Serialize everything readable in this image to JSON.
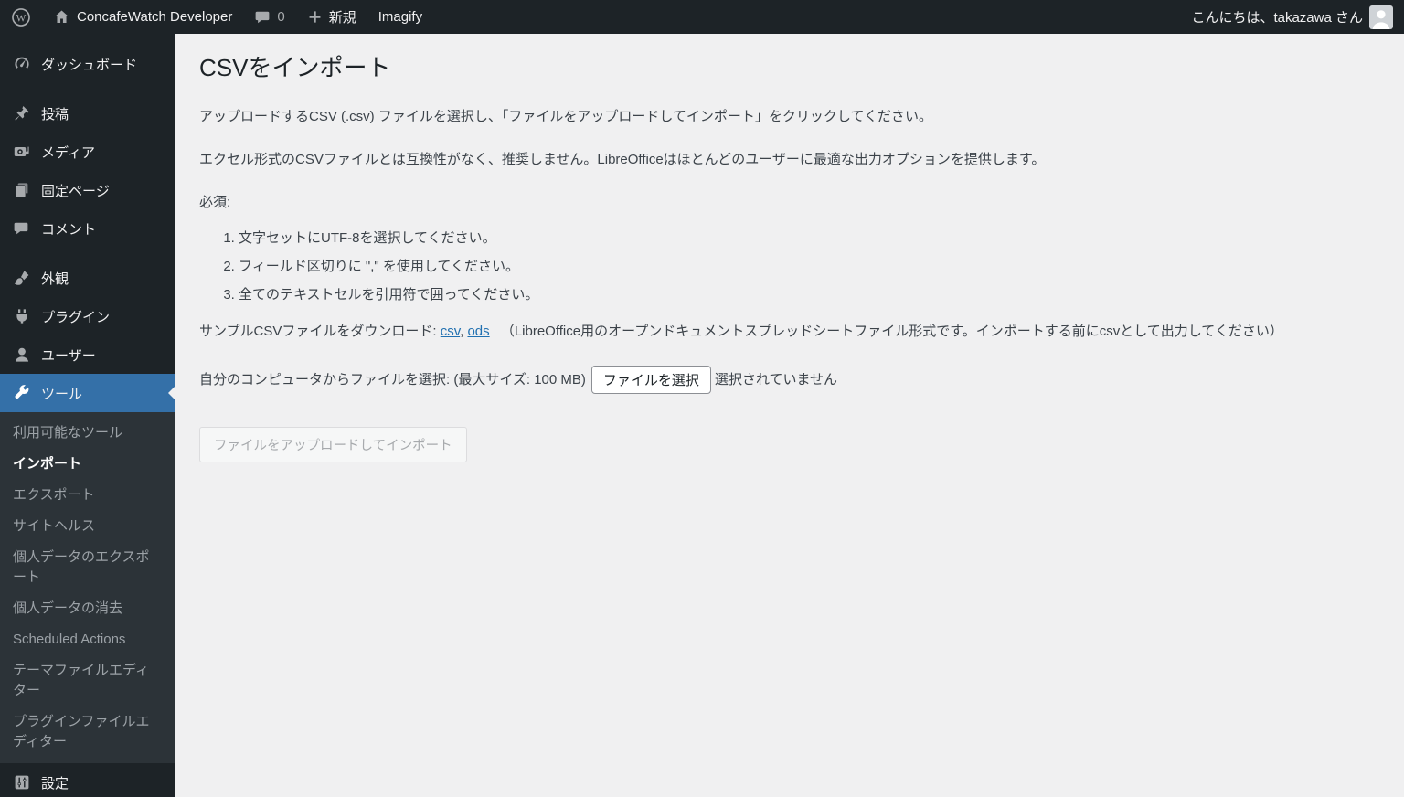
{
  "admin_bar": {
    "site_name": "ConcafeWatch Developer",
    "comment_count": "0",
    "new_button": "新規",
    "imagify": "Imagify",
    "greeting": "こんにちは、takazawa さん"
  },
  "sidebar": {
    "menu": [
      {
        "label": "ダッシュボード"
      },
      {
        "label": "投稿"
      },
      {
        "label": "メディア"
      },
      {
        "label": "固定ページ"
      },
      {
        "label": "コメント"
      },
      {
        "label": "外観"
      },
      {
        "label": "プラグイン"
      },
      {
        "label": "ユーザー"
      },
      {
        "label": "ツール",
        "active": true
      },
      {
        "label": "設定"
      }
    ],
    "tools_submenu": [
      {
        "label": "利用可能なツール"
      },
      {
        "label": "インポート",
        "current": true
      },
      {
        "label": "エクスポート"
      },
      {
        "label": "サイトヘルス"
      },
      {
        "label": "個人データのエクスポート"
      },
      {
        "label": "個人データの消去"
      },
      {
        "label": "Scheduled Actions"
      },
      {
        "label": "テーマファイルエディター"
      },
      {
        "label": "プラグインファイルエディター"
      }
    ]
  },
  "main": {
    "title": "CSVをインポート",
    "intro": "アップロードするCSV (.csv) ファイルを選択し、「ファイルをアップロードしてインポート」をクリックしてください。",
    "excel_note": "エクセル形式のCSVファイルとは互換性がなく、推奨しません。LibreOfficeはほとんどのユーザーに最適な出力オプションを提供します。",
    "required_label": "必須:",
    "requirements": [
      "文字セットにUTF-8を選択してください。",
      "フィールド区切りに \",\" を使用してください。",
      "全てのテキストセルを引用符で囲ってください。"
    ],
    "sample": {
      "prefix": "サンプルCSVファイルをダウンロード:",
      "csv_link": "csv",
      "separator": ",",
      "ods_link": "ods",
      "note": "（LibreOffice用のオープンドキュメントスプレッドシートファイル形式です。インポートする前にcsvとして出力してください）"
    },
    "file_picker": {
      "label": "自分のコンピュータからファイルを選択: (最大サイズ: 100 MB)",
      "button": "ファイルを選択",
      "status": "選択されていません"
    },
    "upload_button": "ファイルをアップロードしてインポート"
  },
  "colors": {
    "admin_bar_bg": "#1d2327",
    "sidebar_bg": "#1d2327",
    "submenu_bg": "#2c3338",
    "active_menu_bg": "#3470a8",
    "content_bg": "#f0f0f1",
    "link": "#2271b1",
    "icon_gray": "#a7aaad",
    "submenu_text": "#9ca2a7",
    "disabled_button_text": "#a7aaad"
  }
}
